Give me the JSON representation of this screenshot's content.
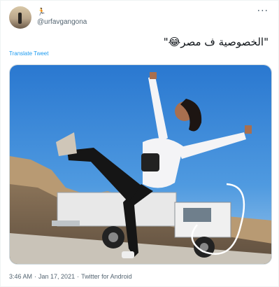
{
  "tweet": {
    "display_name": "🏃",
    "handle": "@urfavgangona",
    "more_label": "···",
    "text": "\"الخصوصية ف مصر😂\"",
    "translate_label": "Translate Tweet",
    "media_icon": "photo-of-woman-dancing-by-pickup-truck",
    "footer": {
      "time": "3:46 AM",
      "separator": "·",
      "date": "Jan 17, 2021",
      "source": "Twitter for Android"
    }
  },
  "colors": {
    "link": "#1d9bf0",
    "secondary_text": "#536471",
    "primary_text": "#0f1419",
    "sky": "#3b86d6"
  }
}
